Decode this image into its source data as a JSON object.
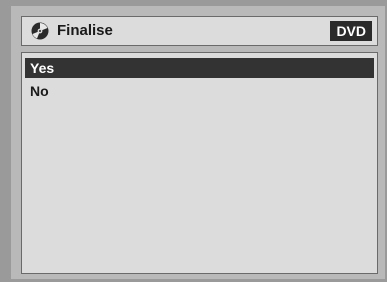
{
  "header": {
    "title": "Finalise",
    "icon": "disc-icon",
    "badge": "DVD"
  },
  "menu": {
    "items": [
      {
        "label": "Yes",
        "selected": true
      },
      {
        "label": "No",
        "selected": false
      }
    ]
  },
  "colors": {
    "background": "#9a9a9a",
    "panel": "#dcdcdc",
    "highlight": "#333333",
    "badge": "#2a2a2a"
  }
}
